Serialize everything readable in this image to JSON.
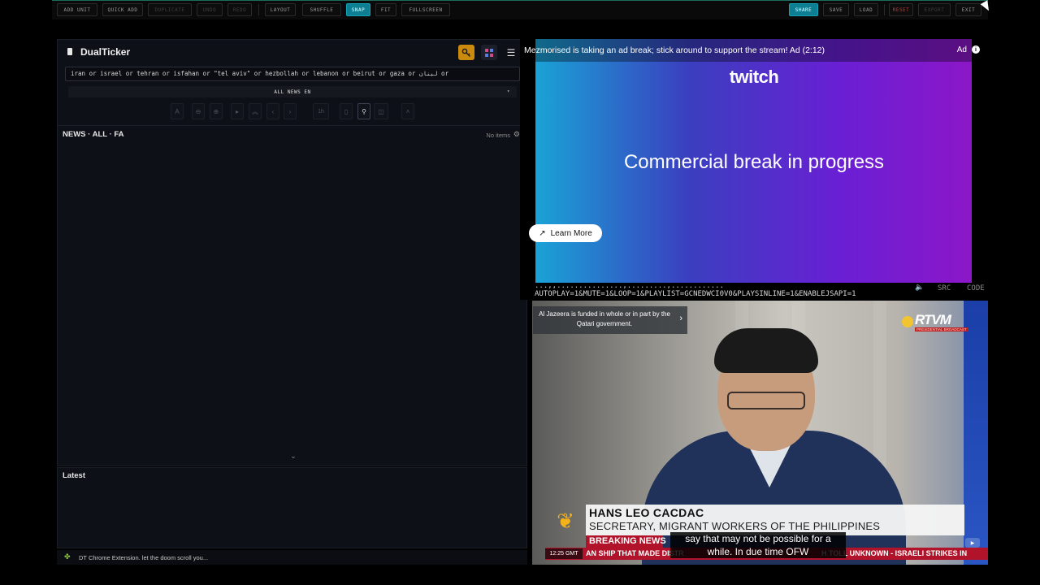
{
  "toolbar": {
    "add_unit": "ADD UNIT",
    "quick_add": "QUICK ADD",
    "duplicate": "DUPLICATE",
    "undo": "UNDO",
    "redo": "REDO",
    "layout": "LAYOUT",
    "shuffle": "SHUFFLE",
    "snap": "SNAP",
    "fit": "FIT",
    "fullscreen": "FULLSCREEN",
    "share": "SHARE",
    "save": "SAVE",
    "load": "LOAD",
    "reset": "RESET",
    "export": "EXPORT",
    "exit": "EXIT"
  },
  "news_panel": {
    "brand": "DualTicker",
    "query": "iran or israel or tehran or isfahan or \"tel aviv\" or hezbollah or lebanon or beirut or gaza or لبنان or",
    "filter": "ALL NEWS EN",
    "time_range": "1h",
    "section_title": "NEWS · ALL · FA",
    "item_count": "No items"
  },
  "latest_panel": {
    "title": "Latest"
  },
  "footer": {
    "text": "DT Chrome Extension. let the doom scroll you..."
  },
  "twitch_ad": {
    "message": "Mezmorised is taking an ad break; stick around to support the stream! Ad (2:12)",
    "ad_label": "Ad",
    "logo": "twitch",
    "headline": "Commercial break in progress",
    "learn_more": "Learn More"
  },
  "url_strip": {
    "line1": "...,,...............,.........,............",
    "line2": "AUTOPLAY=1&MUTE=1&LOOP=1&PLAYLIST=GCNEDWCI0V0&PLAYSINLINE=1&ENABLEJSAPI=1",
    "src": "SRC",
    "code": "CODE"
  },
  "video": {
    "disclaimer": "Al Jazeera is funded in whole or in part by the Qatari government.",
    "rtvm": "RTVM",
    "rtvm_sub": "PRESIDENTIAL BROADCAST",
    "name": "HANS LEO CACDAC",
    "title": "SECRETARY, MIGRANT WORKERS OF THE PHILIPPINES",
    "breaking": "BREAKING NEWS",
    "time": "12:25 GMT",
    "ticker1": "AN SHIP THAT MADE DISTR",
    "ticker2": "H TOLL UNKNOWN  -  ISRAELI STRIKES IN",
    "caption": "say that may not be possible for a while. In due time OFW"
  },
  "colors": {
    "accent": "#0e7f93",
    "panel_bg": "#0d1016",
    "danger": "#d03535",
    "breaking_red": "#b0132a"
  }
}
